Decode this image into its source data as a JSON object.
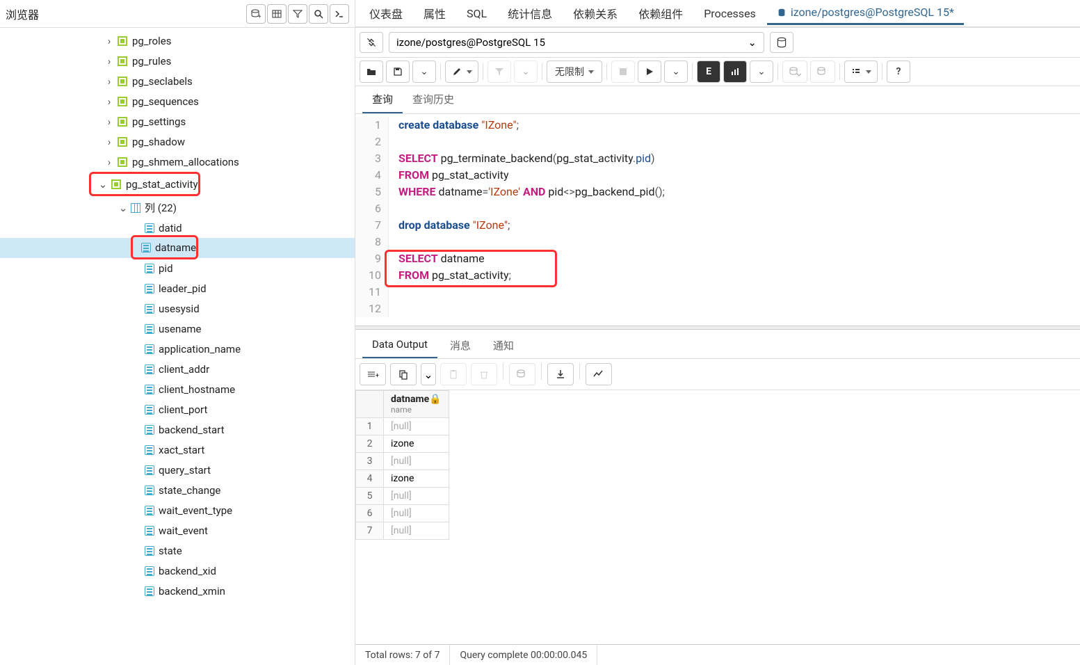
{
  "browser": {
    "title": "浏览器",
    "tree": {
      "views": [
        "pg_roles",
        "pg_rules",
        "pg_seclabels",
        "pg_sequences",
        "pg_settings",
        "pg_shadow",
        "pg_shmem_allocations",
        "pg_stat_activity"
      ],
      "columns_label": "列 (22)",
      "columns": [
        "datid",
        "datname",
        "pid",
        "leader_pid",
        "usesysid",
        "usename",
        "application_name",
        "client_addr",
        "client_hostname",
        "client_port",
        "backend_start",
        "xact_start",
        "query_start",
        "state_change",
        "wait_event_type",
        "wait_event",
        "state",
        "backend_xid",
        "backend_xmin"
      ],
      "highlighted_view": "pg_stat_activity",
      "selected_column": "datname"
    }
  },
  "main_tabs": [
    "仪表盘",
    "属性",
    "SQL",
    "统计信息",
    "依赖关系",
    "依赖组件",
    "Processes"
  ],
  "main_tab_active": "izone/postgres@PostgreSQL 15*",
  "connection": "izone/postgres@PostgreSQL 15",
  "limit_label": "无限制",
  "query_tabs": {
    "query": "查询",
    "history": "查询历史"
  },
  "sql": {
    "lines": [
      {
        "n": 1,
        "tokens": [
          {
            "t": "kw-blue",
            "v": "create"
          },
          {
            "t": "sp"
          },
          {
            "t": "kw-blue",
            "v": "database"
          },
          {
            "t": "sp"
          },
          {
            "t": "str",
            "v": "\"IZone\""
          },
          {
            "t": "punc",
            "v": ";"
          }
        ]
      },
      {
        "n": 2,
        "tokens": []
      },
      {
        "n": 3,
        "tokens": [
          {
            "t": "kw",
            "v": "SELECT"
          },
          {
            "t": "sp"
          },
          {
            "t": "ident",
            "v": "pg_terminate_backend"
          },
          {
            "t": "punc",
            "v": "("
          },
          {
            "t": "ident",
            "v": "pg_stat_activity"
          },
          {
            "t": "punc",
            "v": "."
          },
          {
            "t": "fn",
            "v": "pid"
          },
          {
            "t": "punc",
            "v": ")"
          }
        ]
      },
      {
        "n": 4,
        "tokens": [
          {
            "t": "kw",
            "v": "FROM"
          },
          {
            "t": "sp"
          },
          {
            "t": "ident",
            "v": "pg_stat_activity"
          }
        ]
      },
      {
        "n": 5,
        "tokens": [
          {
            "t": "kw",
            "v": "WHERE"
          },
          {
            "t": "sp"
          },
          {
            "t": "ident",
            "v": "datname"
          },
          {
            "t": "punc",
            "v": "="
          },
          {
            "t": "str",
            "v": "'IZone'"
          },
          {
            "t": "sp"
          },
          {
            "t": "kw",
            "v": "AND"
          },
          {
            "t": "sp"
          },
          {
            "t": "ident",
            "v": "pid"
          },
          {
            "t": "punc",
            "v": "<>"
          },
          {
            "t": "ident",
            "v": "pg_backend_pid"
          },
          {
            "t": "punc",
            "v": "();"
          }
        ]
      },
      {
        "n": 6,
        "tokens": []
      },
      {
        "n": 7,
        "tokens": [
          {
            "t": "kw-blue",
            "v": "drop"
          },
          {
            "t": "sp"
          },
          {
            "t": "kw-blue",
            "v": "database"
          },
          {
            "t": "sp"
          },
          {
            "t": "str",
            "v": "\"IZone\""
          },
          {
            "t": "punc",
            "v": ";"
          }
        ]
      },
      {
        "n": 8,
        "tokens": []
      },
      {
        "n": 9,
        "tokens": [
          {
            "t": "kw",
            "v": "SELECT"
          },
          {
            "t": "sp"
          },
          {
            "t": "ident",
            "v": "datname"
          }
        ]
      },
      {
        "n": 10,
        "tokens": [
          {
            "t": "kw",
            "v": "FROM"
          },
          {
            "t": "sp"
          },
          {
            "t": "ident",
            "v": "pg_stat_activity"
          },
          {
            "t": "punc",
            "v": ";"
          }
        ]
      },
      {
        "n": 11,
        "tokens": []
      },
      {
        "n": 12,
        "tokens": []
      }
    ]
  },
  "output_tabs": {
    "data": "Data Output",
    "messages": "消息",
    "notify": "通知"
  },
  "result": {
    "col_name": "datname",
    "col_type": "name",
    "rows": [
      "[null]",
      "izone",
      "[null]",
      "izone",
      "[null]",
      "[null]",
      "[null]"
    ]
  },
  "status": {
    "rows": "Total rows: 7 of 7",
    "time": "Query complete 00:00:00.045"
  }
}
